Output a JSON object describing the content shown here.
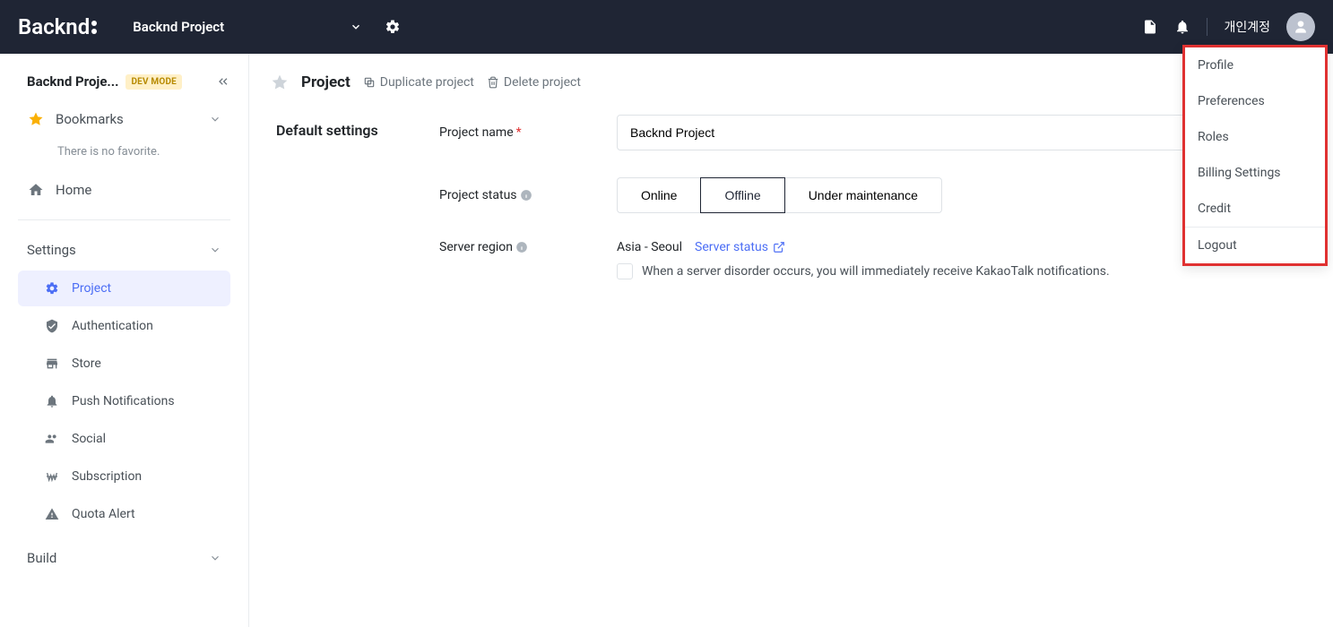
{
  "brand": "Backnd",
  "header": {
    "project_selector": "Backnd Project",
    "account_label": "개인계정"
  },
  "sidebar": {
    "project_title": "Backnd Proje...",
    "dev_badge": "DEV MODE",
    "bookmarks": {
      "label": "Bookmarks",
      "empty": "There is no favorite."
    },
    "home": {
      "label": "Home"
    },
    "settings": {
      "label": "Settings",
      "items": [
        {
          "label": "Project"
        },
        {
          "label": "Authentication"
        },
        {
          "label": "Store"
        },
        {
          "label": "Push Notifications"
        },
        {
          "label": "Social"
        },
        {
          "label": "Subscription"
        },
        {
          "label": "Quota Alert"
        }
      ]
    },
    "build": {
      "label": "Build"
    }
  },
  "page": {
    "title": "Project",
    "actions": {
      "duplicate": "Duplicate project",
      "delete": "Delete project"
    }
  },
  "form": {
    "section_label": "Default settings",
    "labels": {
      "project_name": "Project name",
      "project_status": "Project status",
      "server_region": "Server region"
    },
    "project_name_value": "Backnd Project",
    "status_options": {
      "online": "Online",
      "offline": "Offline",
      "maintenance": "Under maintenance"
    },
    "region_value": "Asia - Seoul",
    "server_status_link": "Server status",
    "kakao_notify": "When a server disorder occurs, you will immediately receive KakaoTalk notifications."
  },
  "dropdown": {
    "profile": "Profile",
    "preferences": "Preferences",
    "roles": "Roles",
    "billing": "Billing Settings",
    "credit": "Credit",
    "logout": "Logout"
  },
  "colors": {
    "accent": "#4c6ef5",
    "header_bg": "#1f2534",
    "highlight_border": "#e03131"
  }
}
